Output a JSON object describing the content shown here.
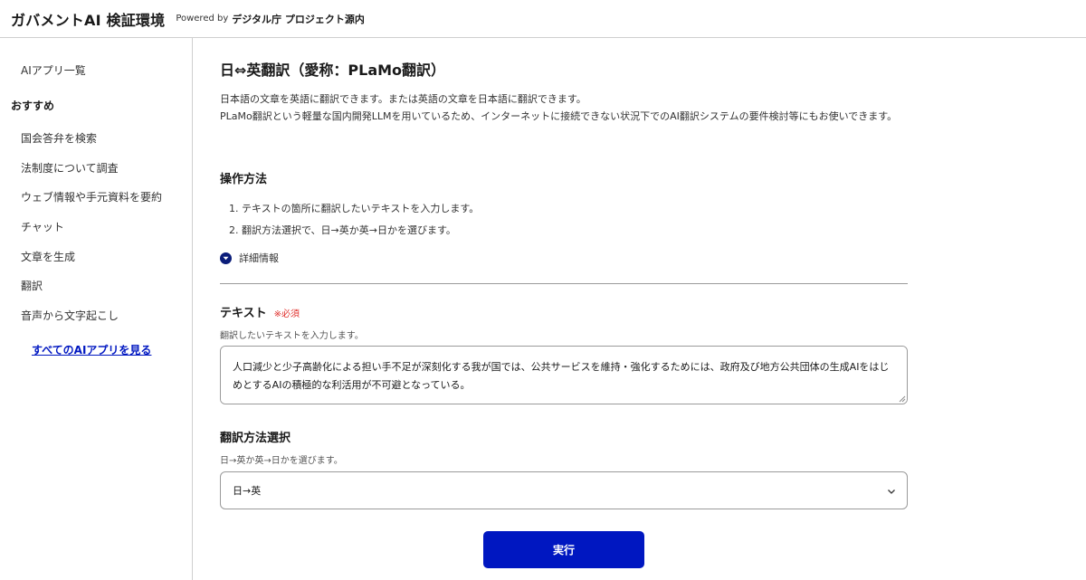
{
  "header": {
    "brand": "ガバメントAI 検証環境",
    "powered_by": "Powered by",
    "org": "デジタル庁 プロジェクト源内"
  },
  "sidebar": {
    "top_item": "AIアプリ一覧",
    "section": "おすすめ",
    "items": [
      {
        "label": "国会答弁を検索"
      },
      {
        "label": "法制度について調査"
      },
      {
        "label": "ウェブ情報や手元資料を要約"
      },
      {
        "label": "チャット"
      },
      {
        "label": "文章を生成"
      },
      {
        "label": "翻訳"
      },
      {
        "label": "音声から文字起こし"
      }
    ],
    "see_all": "すべてのAIアプリを見る"
  },
  "main": {
    "title": "日⇔英翻訳（愛称：PLaMo翻訳）",
    "description_1": "日本語の文章を英語に翻訳できます。または英語の文章を日本語に翻訳できます。",
    "description_2": "PLaMo翻訳という軽量な国内開発LLMを用いているため、インターネットに接続できない状況下でのAI翻訳システムの要件検討等にもお使いできます。",
    "howto_heading": "操作方法",
    "steps": [
      "1. テキストの箇所に翻訳したいテキストを入力します。",
      "2. 翻訳方法選択で、日→英か英→日かを選びます。"
    ],
    "details_label": "詳細情報",
    "text_field": {
      "label": "テキスト",
      "required": "※必須",
      "help": "翻訳したいテキストを入力します。",
      "value": "人口減少と少子高齢化による担い手不足が深刻化する我が国では、公共サービスを維持・強化するためには、政府及び地方公共団体の生成AIをはじめとするAIの積極的な利活用が不可避となっている。"
    },
    "method_field": {
      "label": "翻訳方法選択",
      "help": "日→英か英→日かを選びます。",
      "selected": "日→英"
    },
    "run_button": "実行"
  },
  "colors": {
    "accent": "#0017c1",
    "required": "#e0302c",
    "details_icon": "#0b1d7a"
  }
}
